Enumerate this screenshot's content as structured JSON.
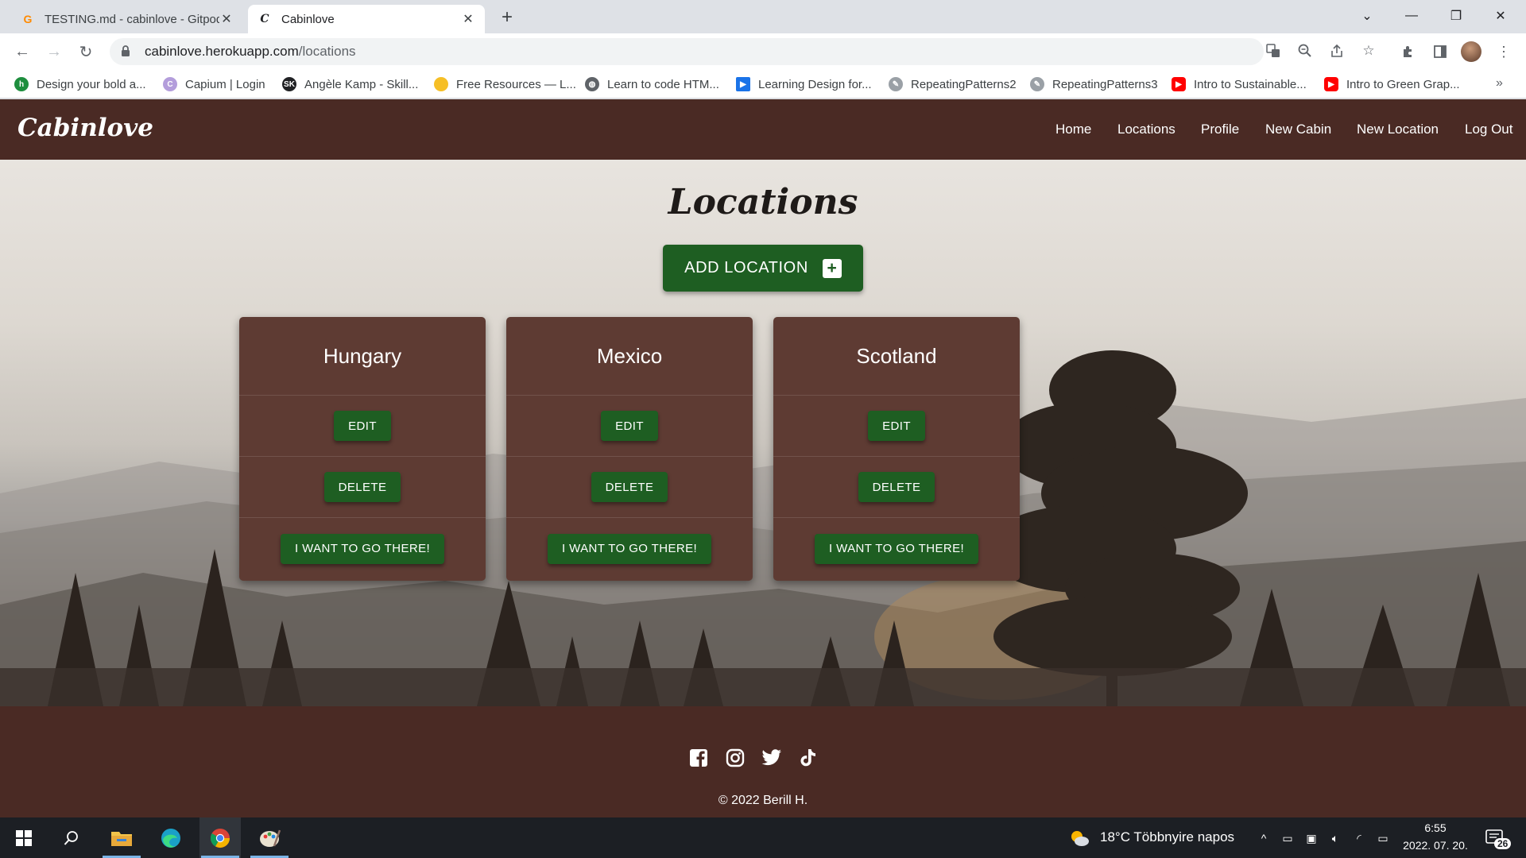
{
  "browser": {
    "tabs": [
      {
        "title": "TESTING.md - cabinlove - Gitpod",
        "close": "✕"
      },
      {
        "title": "Cabinlove",
        "close": "✕"
      }
    ],
    "new_tab": "+",
    "url_host": "cabinlove.herokuapp.com",
    "url_path": "/locations",
    "bookmarks": [
      {
        "label": "Design your bold a...",
        "icon": "bookmark-icon",
        "color": "#1e8e3e"
      },
      {
        "label": "Capium | Login",
        "icon": "bookmark-icon",
        "color": "#b39ddb"
      },
      {
        "label": "Angèle Kamp - Skill...",
        "icon": "bookmark-icon",
        "color": "#202124"
      },
      {
        "label": "Free Resources — L...",
        "icon": "bookmark-icon",
        "color": "#f6bf26"
      },
      {
        "label": "Learn to code HTM...",
        "icon": "globe-icon",
        "color": "#5f6368"
      },
      {
        "label": "Learning Design for...",
        "icon": "bookmark-icon",
        "color": "#1a73e8"
      },
      {
        "label": "RepeatingPatterns2",
        "icon": "bookmark-icon",
        "color": "#5f6368"
      },
      {
        "label": "RepeatingPatterns3",
        "icon": "bookmark-icon",
        "color": "#5f6368"
      },
      {
        "label": "Intro to Sustainable...",
        "icon": "youtube-icon",
        "color": "#ff0000"
      },
      {
        "label": "Intro to Green Grap...",
        "icon": "youtube-icon",
        "color": "#ff0000"
      }
    ],
    "bookmarks_more": "»"
  },
  "site": {
    "brand": "Cabinlove",
    "nav": [
      "Home",
      "Locations",
      "Profile",
      "New Cabin",
      "New Location",
      "Log Out"
    ],
    "page_title": "Locations",
    "add_button": "ADD LOCATION",
    "add_icon": "+",
    "locations": [
      {
        "name": "Hungary",
        "edit": "EDIT",
        "delete": "DELETE",
        "go": "I WANT TO GO THERE!"
      },
      {
        "name": "Mexico",
        "edit": "EDIT",
        "delete": "DELETE",
        "go": "I WANT TO GO THERE!"
      },
      {
        "name": "Scotland",
        "edit": "EDIT",
        "delete": "DELETE",
        "go": "I WANT TO GO THERE!"
      }
    ],
    "social_icons": [
      "facebook-icon",
      "instagram-icon",
      "twitter-icon",
      "tiktok-icon"
    ],
    "copyright": "© 2022 Berill H.",
    "colors": {
      "header": "#4a2a24",
      "card": "#5e3b33",
      "button": "#1e5e22"
    }
  },
  "taskbar": {
    "weather": "18°C  Többnyire napos",
    "time": "6:55",
    "date": "2022. 07. 20.",
    "notifications": "26"
  }
}
